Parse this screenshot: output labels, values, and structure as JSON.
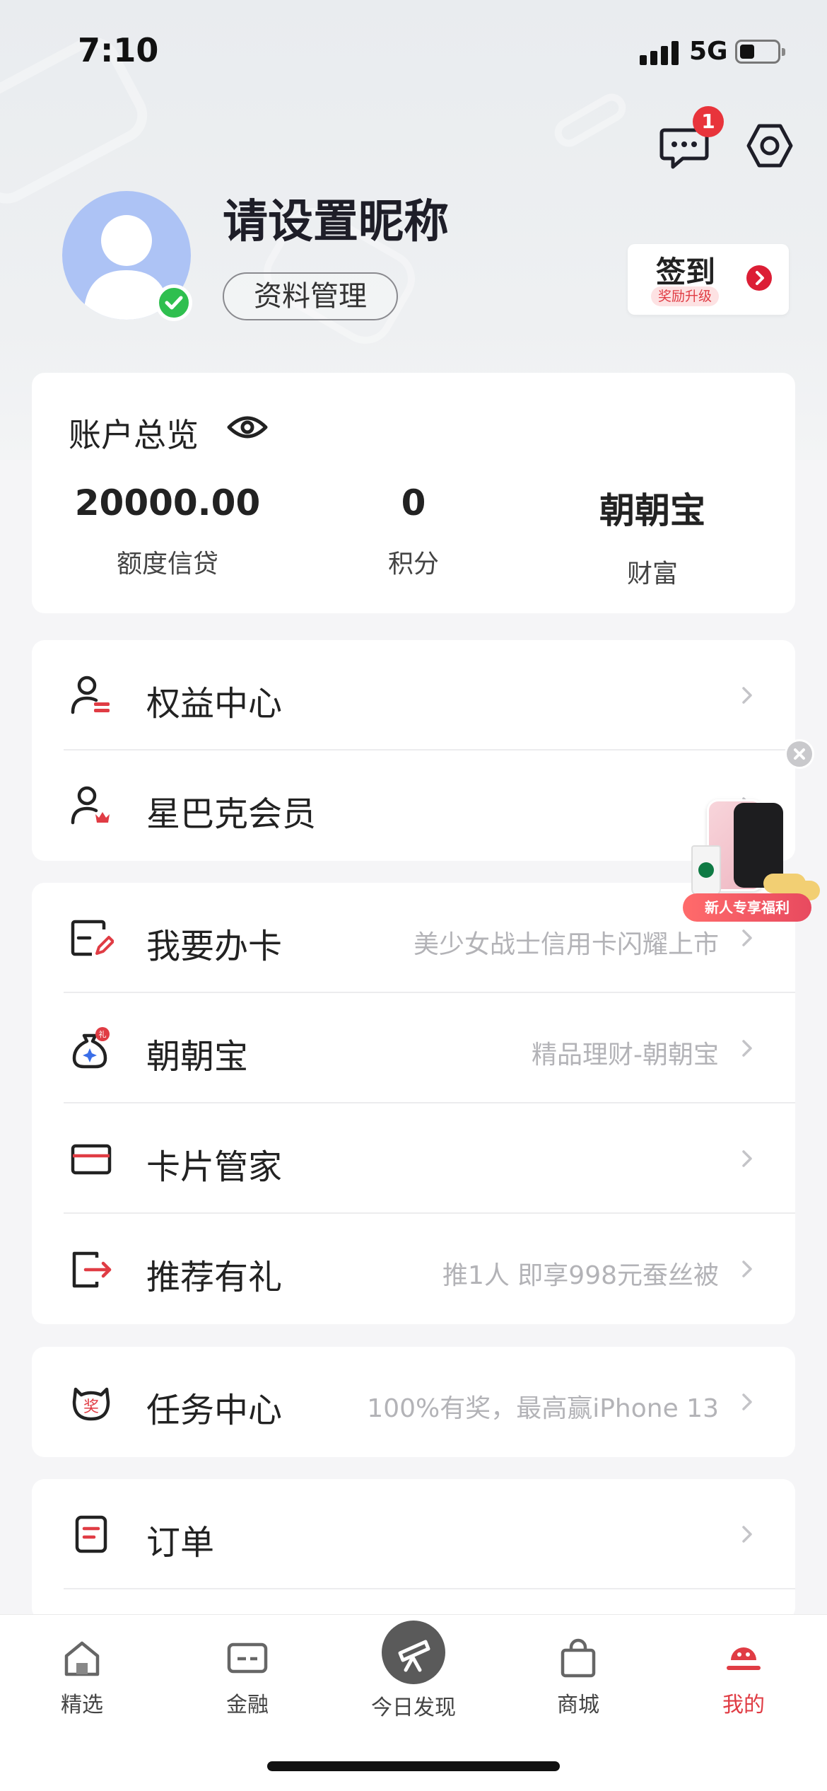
{
  "status_bar": {
    "time": "7:10",
    "network": "5G"
  },
  "header": {
    "message_badge": "1",
    "nickname": "请设置昵称",
    "profile_button": "资料管理",
    "checkin": {
      "title": "签到",
      "subtitle": "奖励升级"
    }
  },
  "overview": {
    "title": "账户总览",
    "stats": [
      {
        "value": "20000.00",
        "label": "额度信贷"
      },
      {
        "value": "0",
        "label": "积分"
      },
      {
        "value": "朝朝宝",
        "label": "财富"
      }
    ]
  },
  "section1": [
    {
      "title": "权益中心",
      "desc": "",
      "icon": "user-card-icon"
    },
    {
      "title": "星巴克会员",
      "desc": "",
      "icon": "user-crown-icon"
    }
  ],
  "section2": [
    {
      "title": "我要办卡",
      "desc": "美少女战士信用卡闪耀上市",
      "icon": "card-edit-icon"
    },
    {
      "title": "朝朝宝",
      "desc": "精品理财-朝朝宝",
      "icon": "money-bag-icon",
      "badge": "礼"
    },
    {
      "title": "卡片管家",
      "desc": "",
      "icon": "card-icon"
    },
    {
      "title": "推荐有礼",
      "desc": "推1人  即享998元蚕丝被",
      "icon": "share-exit-icon"
    }
  ],
  "section3": [
    {
      "title": "任务中心",
      "desc": "100%有奖，最高赢iPhone 13",
      "icon": "reward-tiger-icon",
      "glyph": "奖"
    }
  ],
  "section4": [
    {
      "title": "订单",
      "desc": "",
      "icon": "order-icon"
    }
  ],
  "promo": {
    "label": "新人专享福利"
  },
  "tabbar": [
    {
      "label": "精选",
      "icon": "home-icon"
    },
    {
      "label": "金融",
      "icon": "card-icon"
    },
    {
      "label": "今日发现",
      "icon": "telescope-icon"
    },
    {
      "label": "商城",
      "icon": "shopping-bag-icon"
    },
    {
      "label": "我的",
      "icon": "profile-icon",
      "active": true
    }
  ],
  "colors": {
    "accent": "#e03c44",
    "avatar": "#adc3f5",
    "verified": "#2fbf4f"
  }
}
